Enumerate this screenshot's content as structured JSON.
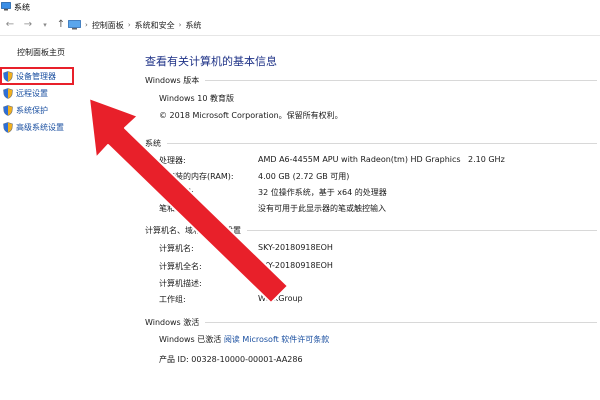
{
  "window": {
    "title": "系统"
  },
  "nav": {
    "breadcrumbs": [
      "控制面板",
      "系统和安全",
      "系统"
    ]
  },
  "sidebar": {
    "home": "控制面板主页",
    "items": [
      {
        "label": "设备管理器"
      },
      {
        "label": "远程设置"
      },
      {
        "label": "系统保护"
      },
      {
        "label": "高级系统设置"
      }
    ]
  },
  "main": {
    "heading": "查看有关计算机的基本信息",
    "edition": {
      "section": "Windows 版本",
      "name": "Windows 10 教育版",
      "copyright": "© 2018 Microsoft Corporation。保留所有权利。"
    },
    "system": {
      "section": "系统",
      "rows": [
        {
          "label": "处理器:",
          "value": "AMD A6-4455M APU with Radeon(tm) HD Graphics",
          "extra": "2.10 GHz"
        },
        {
          "label": "已安装的内存(RAM):",
          "value": "4.00 GB (2.72 GB 可用)"
        },
        {
          "label": "系统类型:",
          "value": "32 位操作系统，基于 x64 的处理器"
        },
        {
          "label": "笔和触控:",
          "value": "没有可用于此显示器的笔或触控输入"
        }
      ]
    },
    "computer": {
      "section": "计算机名、域和工作组设置",
      "rows": [
        {
          "label": "计算机名:",
          "value": "SKY-20180918EOH"
        },
        {
          "label": "计算机全名:",
          "value": "SKY-20180918EOH"
        },
        {
          "label": "计算机描述:",
          "value": ""
        },
        {
          "label": "工作组:",
          "value": "WorkGroup"
        }
      ]
    },
    "activation": {
      "section": "Windows 激活",
      "status": "Windows 已激活",
      "license_link": "阅读 Microsoft 软件许可条款",
      "product_id": "产品 ID: 00328-10000-00001-AA286"
    }
  },
  "colors": {
    "link": "#1a4fa0",
    "heading": "#1e3287",
    "annotation": "#e8202a"
  }
}
